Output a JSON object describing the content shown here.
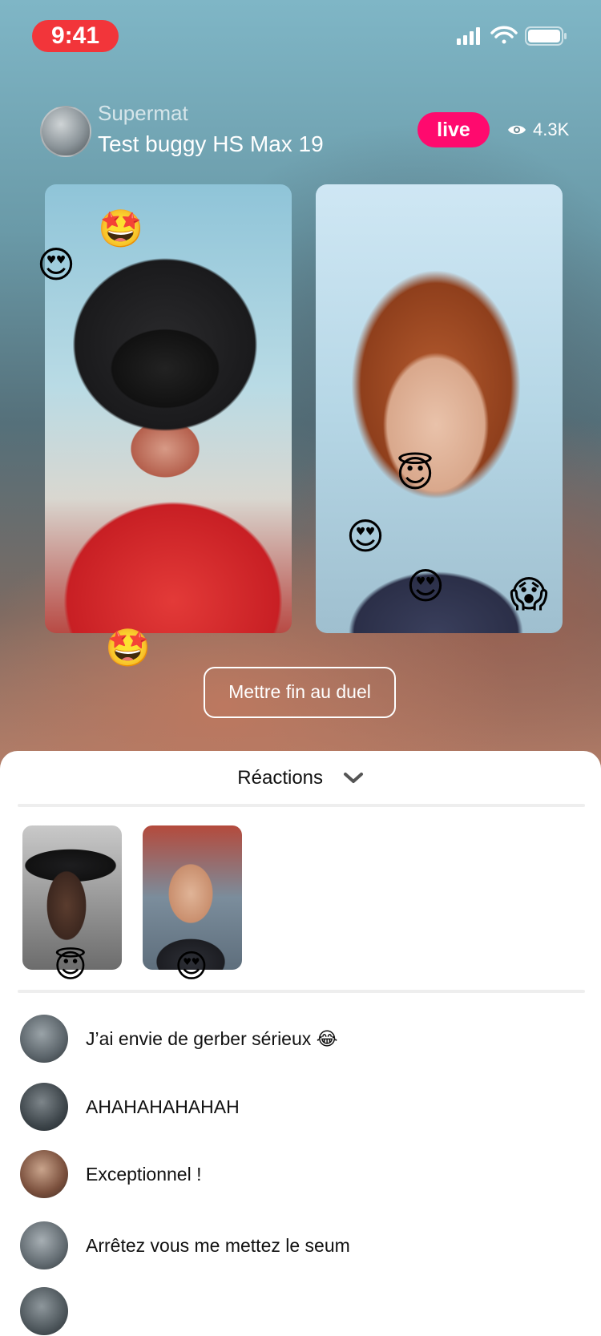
{
  "status_bar": {
    "time": "9:41"
  },
  "header": {
    "host_name": "Supermat",
    "stream_title": "Test buggy HS Max 19",
    "live_label": "live",
    "viewer_count": "4.3K"
  },
  "duel": {
    "left_emojis": [
      "🤩",
      "😍",
      "🤩"
    ],
    "right_emojis": [
      "😇",
      "😍",
      "😍",
      "😱"
    ],
    "end_button_label": "Mettre fin au duel"
  },
  "reactions": {
    "title": "Réactions",
    "reactors": [
      {
        "emoji": "😇"
      },
      {
        "emoji": "😍"
      }
    ]
  },
  "comments": [
    {
      "text": "J’ai envie de gerber sérieux 😂"
    },
    {
      "text": "AHAHAHAHAHAH"
    },
    {
      "text": "Exceptionnel !"
    },
    {
      "text": "Arrêtez vous me mettez le seum"
    }
  ]
}
